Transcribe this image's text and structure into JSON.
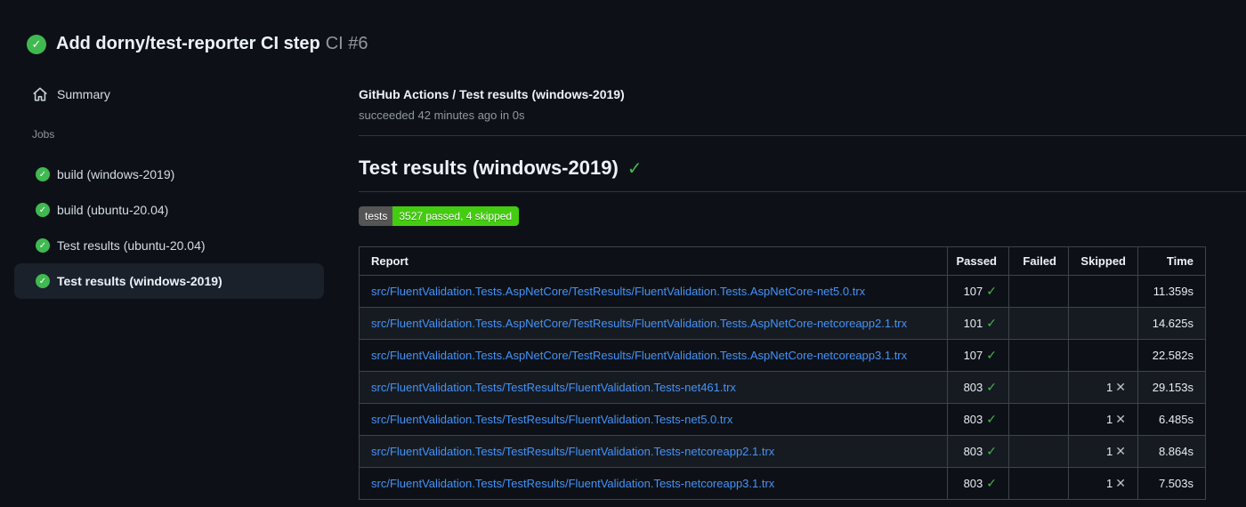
{
  "colors": {
    "bg": "#0d1117",
    "success": "#3fb950",
    "link": "#4493f8",
    "badge-label-bg": "#555555",
    "badge-value-bg": "#44cc11"
  },
  "glyphs": {
    "check": "✓",
    "cross": "✕"
  },
  "header": {
    "title": "Add dorny/test-reporter CI step",
    "run_ref": "CI #6"
  },
  "sidebar": {
    "summary_label": "Summary",
    "jobs_label": "Jobs",
    "jobs": [
      {
        "label": "build (windows-2019)",
        "selected": false
      },
      {
        "label": "build (ubuntu-20.04)",
        "selected": false
      },
      {
        "label": "Test results (ubuntu-20.04)",
        "selected": false
      },
      {
        "label": "Test results (windows-2019)",
        "selected": true
      }
    ]
  },
  "main": {
    "breadcrumb": "GitHub Actions / Test results (windows-2019)",
    "status_line": "succeeded 42 minutes ago in 0s",
    "heading": "Test results (windows-2019)",
    "badge": {
      "label": "tests",
      "value": "3527 passed, 4 skipped"
    },
    "table": {
      "columns": {
        "report": "Report",
        "passed": "Passed",
        "failed": "Failed",
        "skipped": "Skipped",
        "time": "Time"
      },
      "rows": [
        {
          "report": "src/FluentValidation.Tests.AspNetCore/TestResults/FluentValidation.Tests.AspNetCore-net5.0.trx",
          "passed": "107",
          "failed": "",
          "skipped": "",
          "time": "11.359s"
        },
        {
          "report": "src/FluentValidation.Tests.AspNetCore/TestResults/FluentValidation.Tests.AspNetCore-netcoreapp2.1.trx",
          "passed": "101",
          "failed": "",
          "skipped": "",
          "time": "14.625s"
        },
        {
          "report": "src/FluentValidation.Tests.AspNetCore/TestResults/FluentValidation.Tests.AspNetCore-netcoreapp3.1.trx",
          "passed": "107",
          "failed": "",
          "skipped": "",
          "time": "22.582s"
        },
        {
          "report": "src/FluentValidation.Tests/TestResults/FluentValidation.Tests-net461.trx",
          "passed": "803",
          "failed": "",
          "skipped": "1",
          "time": "29.153s"
        },
        {
          "report": "src/FluentValidation.Tests/TestResults/FluentValidation.Tests-net5.0.trx",
          "passed": "803",
          "failed": "",
          "skipped": "1",
          "time": "6.485s"
        },
        {
          "report": "src/FluentValidation.Tests/TestResults/FluentValidation.Tests-netcoreapp2.1.trx",
          "passed": "803",
          "failed": "",
          "skipped": "1",
          "time": "8.864s"
        },
        {
          "report": "src/FluentValidation.Tests/TestResults/FluentValidation.Tests-netcoreapp3.1.trx",
          "passed": "803",
          "failed": "",
          "skipped": "1",
          "time": "7.503s"
        }
      ]
    }
  }
}
